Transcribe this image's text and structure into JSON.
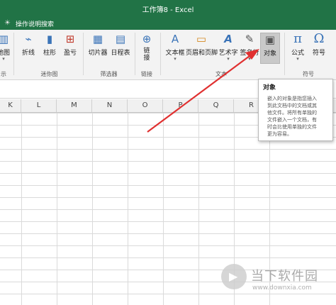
{
  "window": {
    "title": "工作簿8 - Excel"
  },
  "help": {
    "icon": "lightbulb-icon",
    "label": "操作说明搜索"
  },
  "ribbon": {
    "buttons": {
      "map": {
        "label": "地图",
        "icon": "▥"
      },
      "line": {
        "label": "折线",
        "icon": "⌁"
      },
      "column": {
        "label": "柱形",
        "icon": "▮"
      },
      "winloss": {
        "label": "盈亏",
        "icon": "⊞"
      },
      "slicer": {
        "label": "切片器",
        "icon": "▦"
      },
      "timeline": {
        "label": "日程表",
        "icon": "▤"
      },
      "link": {
        "label": "链接",
        "icon": "⊕"
      },
      "textbox": {
        "label": "文本框",
        "icon": "A"
      },
      "headerfooter": {
        "label": "页眉和页脚",
        "icon": "▭"
      },
      "wordart": {
        "label": "艺术字",
        "icon": "A"
      },
      "signature": {
        "label": "签名行",
        "icon": "✎"
      },
      "object": {
        "label": "对象",
        "icon": "▣"
      },
      "equation": {
        "label": "公式",
        "icon": "π"
      },
      "symbol": {
        "label": "符号",
        "icon": "Ω"
      }
    },
    "groups": {
      "display": "示",
      "sparklines": "迷你图",
      "filters": "筛选器",
      "links": "链接",
      "text": "文本",
      "symbols": "符号"
    }
  },
  "columns": [
    "K",
    "L",
    "M",
    "N",
    "O",
    "P",
    "Q",
    "R"
  ],
  "tooltip": {
    "title": "对象",
    "lines": [
      "嵌入的对象是指您插入",
      "到此文档中的文档或其",
      "他文件。将所有单独的",
      "文件嵌入一个文档，有",
      "时会比使用单独的文件",
      "更为容易。"
    ]
  },
  "watermark": {
    "text": "当下软件园",
    "url": "www.downxia.com"
  },
  "colors": {
    "excel_green": "#217346",
    "arrow_red": "#e03030"
  }
}
